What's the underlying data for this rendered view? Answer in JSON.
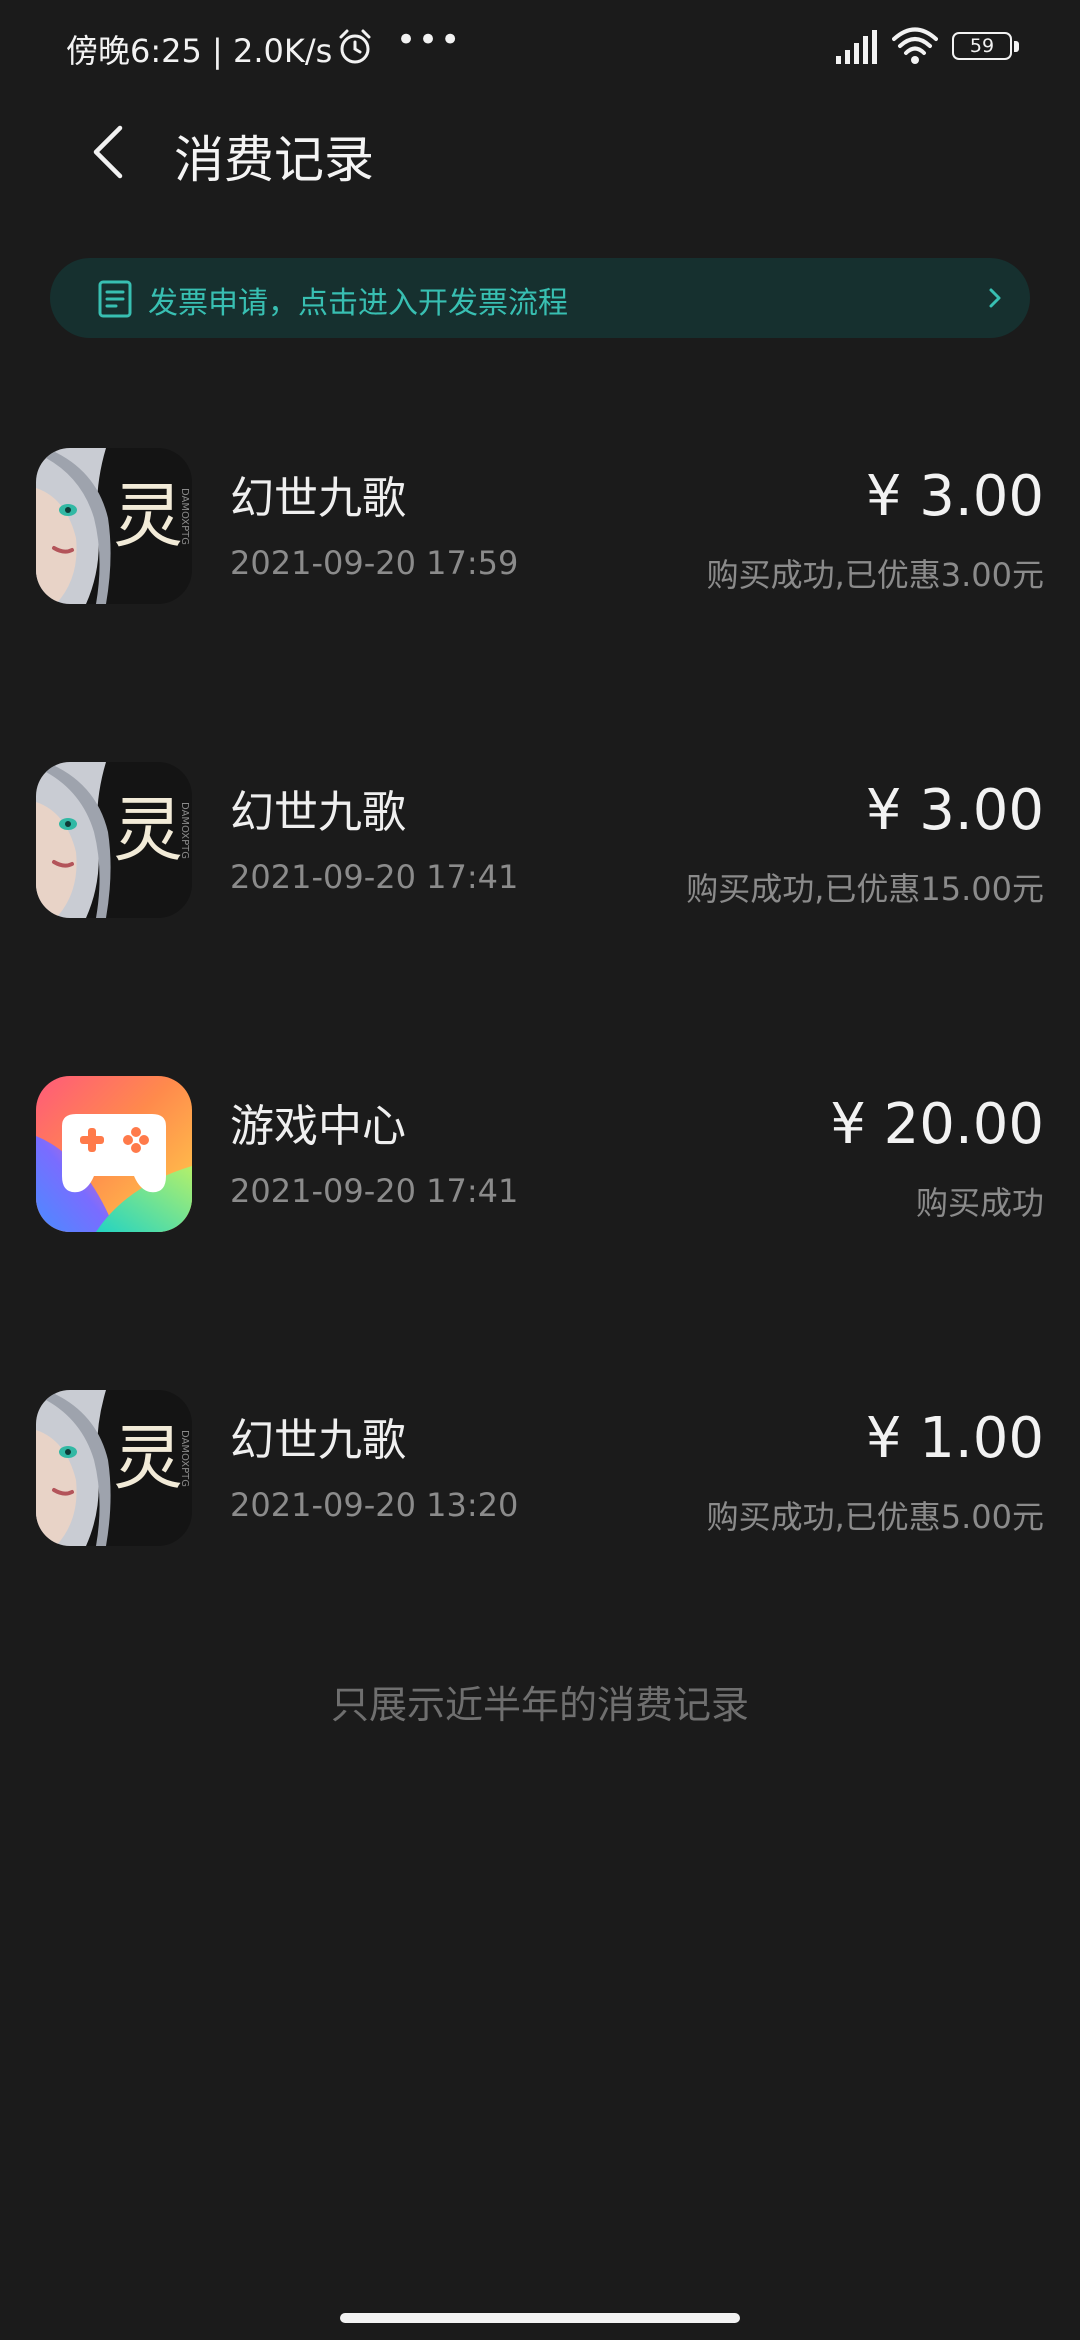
{
  "status_bar": {
    "time_text": "傍晚6:25 | 2.0K/s",
    "more_dots": "•••",
    "battery_level": "59"
  },
  "header": {
    "back_icon": "chevron-left-icon",
    "title": "消费记录"
  },
  "invoice_banner": {
    "icon": "receipt-icon",
    "text": "发票申请，点击进入开发票流程",
    "chevron_icon": "chevron-right-icon",
    "text_color": "#38bfb2",
    "background_color": "#16302f"
  },
  "records": [
    {
      "icon": "game-linghuan-icon",
      "name": "幻世九歌",
      "time": "2021-09-20 17:59",
      "amount": "¥ 3.00",
      "status": "购买成功,已优惠3.00元"
    },
    {
      "icon": "game-linghuan-icon",
      "name": "幻世九歌",
      "time": "2021-09-20 17:41",
      "amount": "¥ 3.00",
      "status": "购买成功,已优惠15.00元"
    },
    {
      "icon": "game-center-icon",
      "name": "游戏中心",
      "time": "2021-09-20 17:41",
      "amount": "¥ 20.00",
      "status": "购买成功"
    },
    {
      "icon": "game-linghuan-icon",
      "name": "幻世九歌",
      "time": "2021-09-20 13:20",
      "amount": "¥ 1.00",
      "status": "购买成功,已优惠5.00元"
    }
  ],
  "footer_note": "只展示近半年的消费记录",
  "colors": {
    "background": "#1b1b1b",
    "primary_text": "#efefef",
    "secondary_text": "#8b8b8b",
    "accent": "#38bfb2"
  }
}
